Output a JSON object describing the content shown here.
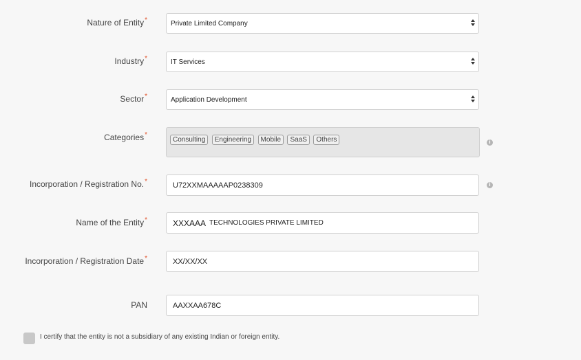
{
  "form": {
    "nature_of_entity": {
      "label": "Nature of Entity",
      "value": "Private Limited Company"
    },
    "industry": {
      "label": "Industry",
      "value": "IT Services"
    },
    "sector": {
      "label": "Sector",
      "value": "Application Development"
    },
    "categories": {
      "label": "Categories",
      "tags": [
        "Consulting",
        "Engineering",
        "Mobile",
        "SaaS",
        "Others"
      ]
    },
    "registration_no": {
      "label": "Incorporation / Registration No.",
      "value": "U72XXMAAAAAP0238309"
    },
    "entity_name": {
      "label": "Name of the Entity",
      "value_prefix": "XXXAAA",
      "value": "TECHNOLOGIES PRIVATE LIMITED"
    },
    "registration_date": {
      "label": "Incorporation / Registration Date",
      "value": "XX/XX/XX"
    },
    "pan": {
      "label": "PAN",
      "value": "AAXXAA678C"
    },
    "required_mark": "*",
    "certify_text": "I certify that the entity is not a subsidiary of any existing Indian or foreign entity."
  },
  "icons": {
    "info": "info-icon",
    "select_arrows": "select-arrows-icon",
    "checkbox": "checkbox-icon"
  },
  "colors": {
    "required": "#e0522b",
    "background": "#f7f7f7"
  }
}
